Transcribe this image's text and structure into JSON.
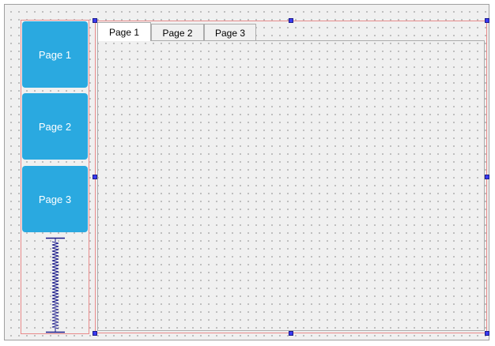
{
  "left_panel": {
    "buttons": [
      {
        "label": "Page 1"
      },
      {
        "label": "Page 2"
      },
      {
        "label": "Page 3"
      }
    ]
  },
  "tab_widget": {
    "tabs": [
      {
        "label": "Page 1",
        "active": true
      },
      {
        "label": "Page 2",
        "active": false
      },
      {
        "label": "Page 3",
        "active": false
      }
    ]
  },
  "colors": {
    "button_bg": "#2aa9e0",
    "layout_border": "#e98b8b",
    "handle": "#3a3af0",
    "spacer": "#1b1b8a"
  }
}
